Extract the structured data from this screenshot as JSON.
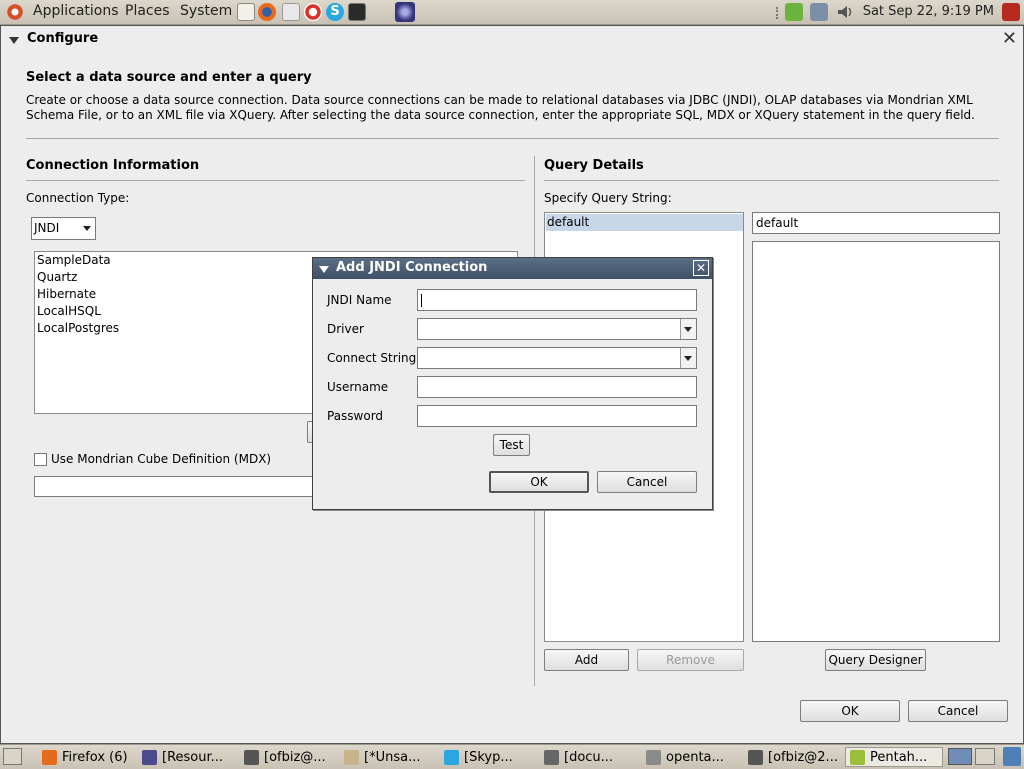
{
  "top_panel": {
    "menus": [
      "Applications",
      "Places",
      "System"
    ],
    "clock": "Sat Sep 22,  9:19 PM"
  },
  "configure": {
    "title": "Configure",
    "heading": "Select a data source and enter a query",
    "description": "Create or choose a data source connection. Data source connections can be made to relational databases via JDBC (JNDI), OLAP databases via Mondrian XML Schema File, or to an XML file via XQuery. After selecting the data source connection, enter the appropriate SQL, MDX or XQuery statement in the query field.",
    "connection": {
      "section_title": "Connection Information",
      "type_label": "Connection Type:",
      "type_value": "JNDI",
      "connections": [
        "SampleData",
        "Quartz",
        "Hibernate",
        "LocalHSQL",
        "LocalPostgres"
      ],
      "mondrian_checkbox_label": "Use Mondrian Cube Definition (MDX)",
      "mondrian_checked": false,
      "mondrian_path": ""
    },
    "query": {
      "section_title": "Query Details",
      "specify_label": "Specify Query String:",
      "queries": [
        "default"
      ],
      "selected_query": "default",
      "query_name": "default",
      "query_text": "",
      "add_label": "Add",
      "remove_label": "Remove",
      "designer_label": "Query Designer"
    },
    "ok_label": "OK",
    "cancel_label": "Cancel"
  },
  "jndi_dialog": {
    "title": "Add JNDI Connection",
    "jndi_name_label": "JNDI Name",
    "jndi_name_value": "",
    "driver_label": "Driver",
    "driver_value": "",
    "connect_string_label": "Connect String",
    "connect_string_value": "",
    "username_label": "Username",
    "username_value": "",
    "password_label": "Password",
    "password_value": "",
    "test_label": "Test",
    "ok_label": "OK",
    "cancel_label": "Cancel"
  },
  "taskbar": {
    "tasks": [
      {
        "label": "Firefox (6)",
        "icon": "firefox-icon",
        "color": "#e66a1e"
      },
      {
        "label": "[Resour...",
        "icon": "eclipse-icon",
        "color": "#4a4a8c"
      },
      {
        "label": "[ofbiz@...",
        "icon": "terminal-icon",
        "color": "#555555"
      },
      {
        "label": "[*Unsa...",
        "icon": "text-editor-icon",
        "color": "#c8b48a"
      },
      {
        "label": "[Skyp...",
        "icon": "skype-icon",
        "color": "#2aa7e0"
      },
      {
        "label": "[docu...",
        "icon": "window-icon",
        "color": "#666666"
      },
      {
        "label": "openta...",
        "icon": "document-icon",
        "color": "#8a8a8a"
      },
      {
        "label": "[ofbiz@2...",
        "icon": "terminal-icon",
        "color": "#555555"
      },
      {
        "label": "Pentah...",
        "icon": "pentaho-icon",
        "color": "#9bbf3a"
      }
    ]
  }
}
